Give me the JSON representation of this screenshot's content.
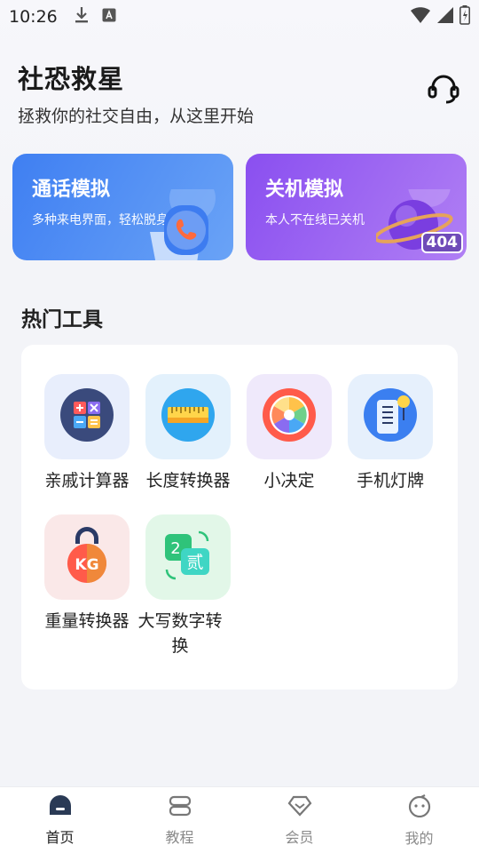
{
  "status_bar": {
    "time": "10:26"
  },
  "header": {
    "title": "社恐救星",
    "subtitle": "拯救你的社交自由，从这里开始"
  },
  "banners": [
    {
      "title": "通话模拟",
      "desc": "多种来电界面，轻松脱身"
    },
    {
      "title": "关机模拟",
      "desc": "本人不在线已关机",
      "badge": "404"
    }
  ],
  "section": {
    "title": "热门工具"
  },
  "tools": [
    {
      "label": "亲戚计算器",
      "icon": "calculator-icon"
    },
    {
      "label": "长度转换器",
      "icon": "ruler-icon"
    },
    {
      "label": "小决定",
      "icon": "spinner-wheel-icon"
    },
    {
      "label": "手机灯牌",
      "icon": "phone-sign-icon"
    },
    {
      "label": "重量转换器",
      "icon": "kettlebell-icon",
      "badge": "KG"
    },
    {
      "label": "大写数字转换",
      "icon": "number-convert-icon",
      "from": "2",
      "to": "贰"
    }
  ],
  "tabbar": [
    {
      "label": "首页",
      "active": true
    },
    {
      "label": "教程",
      "active": false
    },
    {
      "label": "会员",
      "active": false
    },
    {
      "label": "我的",
      "active": false
    }
  ],
  "colors": {
    "primary_blue": "#3f7ff2",
    "primary_purple": "#8a4ff0"
  }
}
